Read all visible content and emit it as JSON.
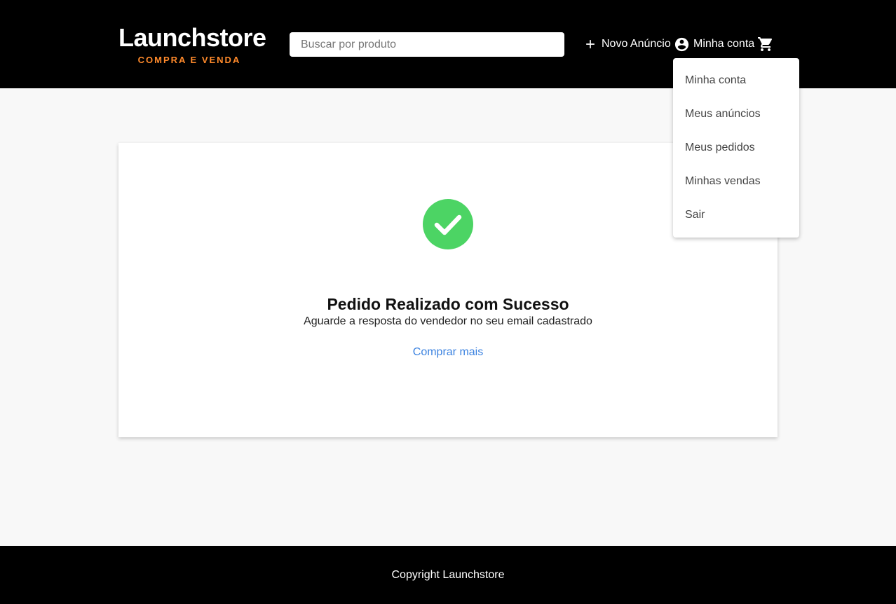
{
  "header": {
    "logo_title": "Launchstore",
    "logo_subtitle": "COMPRA E VENDA",
    "search_placeholder": "Buscar por produto",
    "new_ad_label": "Novo Anúncio",
    "account_label": "Minha conta",
    "icons": {
      "new_ad": "plus-icon",
      "account": "account-circle-icon",
      "cart": "shopping-cart-icon"
    }
  },
  "account_menu": {
    "items": [
      {
        "label": "Minha conta"
      },
      {
        "label": "Meus anúncios"
      },
      {
        "label": "Meus pedidos"
      },
      {
        "label": "Minhas vendas"
      },
      {
        "label": "Sair"
      }
    ]
  },
  "success_card": {
    "icon": "check-circle-icon",
    "title": "Pedido Realizado com Sucesso",
    "message": "Aguarde a resposta do vendedor no seu email cadastrado",
    "link_label": "Comprar mais"
  },
  "footer": {
    "text": "Copyright Launchstore"
  },
  "colors": {
    "header_bg": "#000000",
    "accent_orange": "#ff8a2b",
    "success_green": "#4cd464",
    "link_blue": "#3b82e0",
    "page_bg": "#f8f8f8"
  }
}
